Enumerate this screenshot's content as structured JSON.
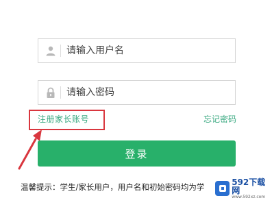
{
  "login_form": {
    "username": {
      "placeholder": "请输入用户名",
      "value": ""
    },
    "password": {
      "placeholder": "请输入密码",
      "value": ""
    },
    "register_link": "注册家长账号",
    "forgot_link": "忘记密码",
    "login_button": "登录",
    "hint": "温馨提示：学生/家长用户，用户名和初始密码均为学"
  },
  "annotation": {
    "highlight_color": "#d9363e"
  },
  "accent_color": "#28b06a",
  "link_color": "#3aa981",
  "watermark": {
    "main": "592下载网",
    "sub": "www.592xz.com"
  }
}
